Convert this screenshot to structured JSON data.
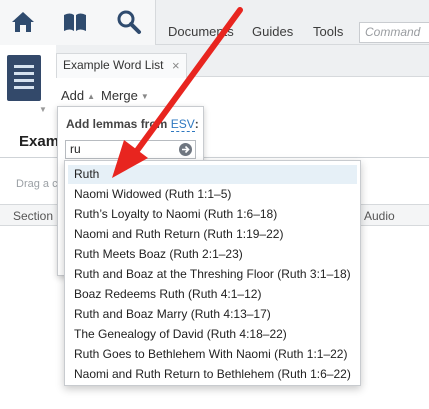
{
  "topnav": {
    "icons": [
      "home-icon",
      "library-icon",
      "search-icon"
    ],
    "menus": [
      "Documents",
      "Guides",
      "Tools"
    ],
    "command_placeholder": "Command"
  },
  "tab": {
    "title": "Example Word List",
    "close": "×"
  },
  "toolbar": {
    "add_label": "Add",
    "merge_label": "Merge"
  },
  "document": {
    "title": "Example Word List",
    "drag_hint": "Drag a column header here to group by that column",
    "columns": [
      "Section",
      "Audio"
    ]
  },
  "popup": {
    "label_prefix": "Add lemmas from",
    "source": "ESV",
    "label_suffix": ":",
    "search_value": "ru"
  },
  "suggestions": [
    "Ruth",
    "Naomi Widowed (Ruth 1:1–5)",
    "Ruth’s Loyalty to Naomi (Ruth 1:6–18)",
    "Naomi and Ruth Return (Ruth 1:19–22)",
    "Ruth Meets Boaz (Ruth 2:1–23)",
    "Ruth and Boaz at the Threshing Floor (Ruth 3:1–18)",
    "Boaz Redeems Ruth (Ruth 4:1–12)",
    "Ruth and Boaz Marry (Ruth 4:13–17)",
    "The Genealogy of David (Ruth 4:18–22)",
    "Ruth Goes to Bethlehem With Naomi (Ruth 1:1–22)",
    "Naomi and Ruth Return to Bethlehem (Ruth 1:6–22)"
  ],
  "colors": {
    "accent": "#2e78c0",
    "panel_button": "#33496a",
    "annotation_arrow": "#e8251f",
    "selected_row": "#e6f0f7"
  }
}
